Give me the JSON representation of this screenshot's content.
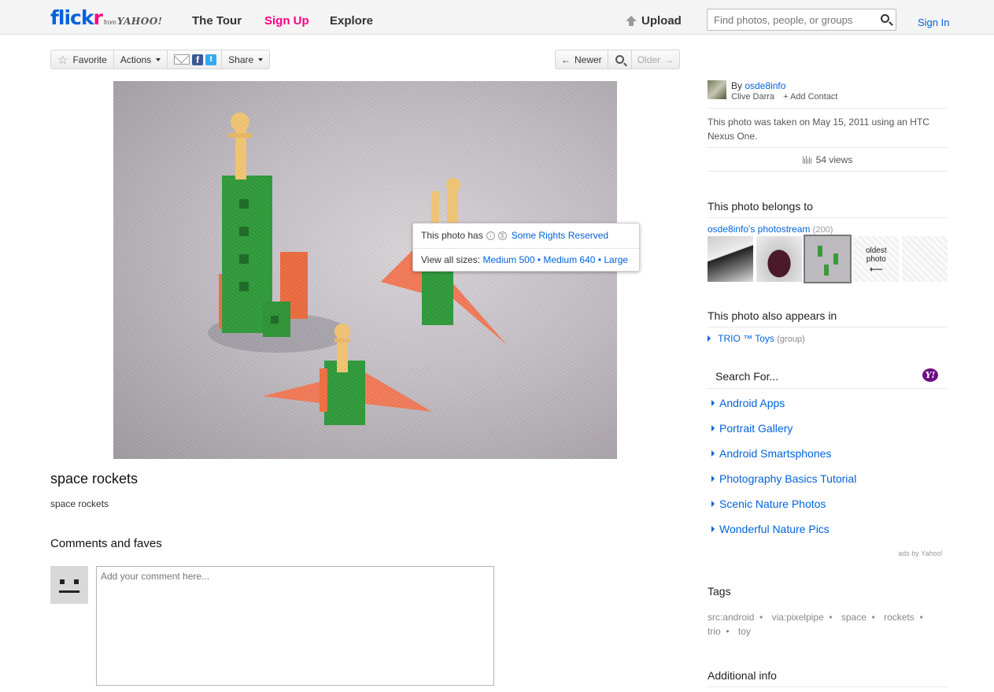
{
  "header": {
    "logo_left": "flick",
    "logo_right": "r",
    "logo_from": "from",
    "logo_yahoo": "YAHOO!",
    "nav": [
      "The Tour",
      "Sign Up",
      "Explore"
    ],
    "upload": "Upload",
    "search_placeholder": "Find photos, people, or groups",
    "sign_in": "Sign In"
  },
  "toolbar": {
    "favorite": "Favorite",
    "actions": "Actions",
    "share": "Share",
    "newer": "Newer",
    "older": "Older"
  },
  "photo_popup": {
    "rights_prefix": "This photo has",
    "rights_link": "Some Rights Reserved",
    "sizes_prefix": "View all sizes:",
    "sizes": [
      "Medium 500",
      "Medium 640",
      "Large"
    ],
    "separator": "•"
  },
  "photo": {
    "title": "space rockets",
    "description": "space rockets"
  },
  "comments": {
    "heading": "Comments and faves",
    "placeholder": "Add your comment here..."
  },
  "sidebar": {
    "by_label": "By",
    "username": "osde8info",
    "real_name": "Clive Darra",
    "add_contact": "+ Add Contact",
    "taken_text": "This photo was taken on May 15, 2011 using an HTC Nexus One.",
    "views": "54 views",
    "belongs_heading": "This photo belongs to",
    "photostream": "osde8info's photostream",
    "photostream_count": "(200)",
    "oldest_label": "oldest photo",
    "oldest_arrow": "⟵",
    "also_heading": "This photo also appears in",
    "group_name": "TRIO ™ Toys",
    "group_type": "(group)",
    "search_for": "Search For...",
    "yahoo_mark": "Y!",
    "ads": [
      "Android Apps",
      "Portrait Gallery",
      "Android Smartsphones",
      "Photography Basics Tutorial",
      "Scenic Nature Photos",
      "Wonderful Nature Pics"
    ],
    "ads_by": "ads by Yahoo!",
    "tags_heading": "Tags",
    "tags": [
      "src:android",
      "via:pixelpipe",
      "space",
      "rockets",
      "trio",
      "toy"
    ],
    "additional_heading": "Additional info"
  },
  "colors": {
    "flickr_blue": "#0063dc",
    "flickr_pink": "#ff0084",
    "yahoo_purple": "#6d0d86"
  }
}
